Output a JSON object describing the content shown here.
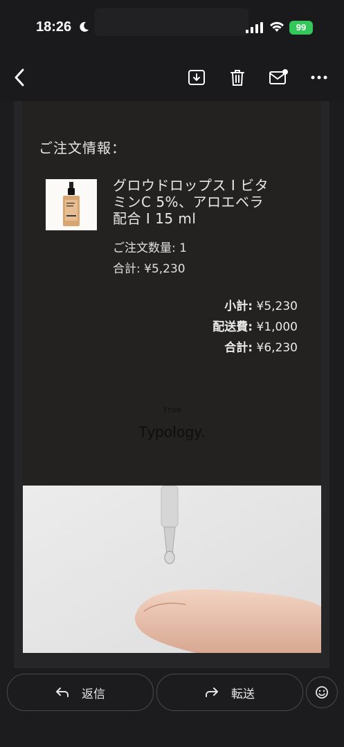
{
  "status_bar": {
    "time": "18:26",
    "battery": "99"
  },
  "toolbar": {
    "icons": [
      "back-chevron-icon",
      "archive-icon",
      "trash-icon",
      "mail-unread-icon",
      "more-icon"
    ]
  },
  "email": {
    "order_heading": "ご注文情報：",
    "product": {
      "name_line1": "グロウドロップス I ビタ",
      "name_line2": "ミンC 5%、アロエベラ",
      "name_line3": "配合 I 15 ml",
      "quantity": "ご注文数量: 1",
      "total": "合計: ¥5,230"
    },
    "summary": {
      "subtotal_label": "小計:",
      "subtotal_value": "¥5,230",
      "shipping_label": "配送費:",
      "shipping_value": "¥1,000",
      "total_label": "合計:",
      "total_value": "¥6,230"
    },
    "footer_from": "from",
    "brand": "Typology."
  },
  "actions": {
    "reply_label": "返信",
    "forward_label": "転送"
  },
  "colors": {
    "background": "#1c1c1e",
    "battery": "#34c759",
    "email_bg": "#232221"
  }
}
